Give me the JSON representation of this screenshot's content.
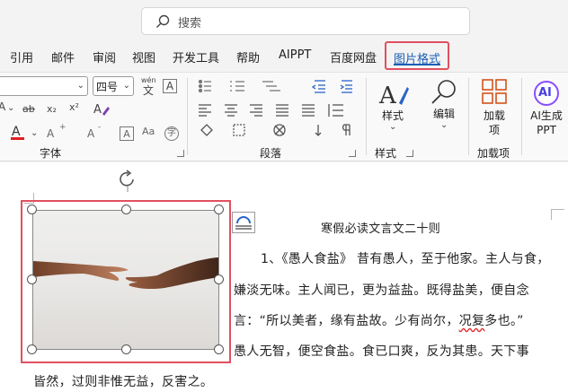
{
  "search": {
    "placeholder": "搜索"
  },
  "tabs": [
    {
      "label": "引用",
      "active": false
    },
    {
      "label": "邮件",
      "active": false
    },
    {
      "label": "审阅",
      "active": false
    },
    {
      "label": "视图",
      "active": false
    },
    {
      "label": "开发工具",
      "active": false
    },
    {
      "label": "帮助",
      "active": false
    },
    {
      "label": "AIPPT",
      "active": false
    },
    {
      "label": "百度网盘",
      "active": false
    },
    {
      "label": "图片格式",
      "active": true
    }
  ],
  "ribbon": {
    "font_size_value": "四号",
    "wen_label": "wén",
    "wen_char": "文",
    "char_a": "A",
    "font_group_label": "字体",
    "para_group_label": "段落",
    "styles_button_label": "样式",
    "styles_group_label": "样式",
    "edit_button_label": "编辑",
    "addin_button_label": "加载项",
    "addin_group_label": "加载项",
    "ai_badge_text": "AI",
    "ai_button_label": "AI生成PPT",
    "strike_label": "ab",
    "sub_label": "x₂",
    "sup_label": "x²",
    "font_color_a": "A",
    "highlight_color": "#f4e94a",
    "font_color": "#e02020",
    "font_color_bar": "#e02020"
  },
  "document": {
    "title": "寒假必读文言文二十则",
    "lines": [
      "1、《愚人食盐》 昔有愚人，至于他家。主人与食，",
      "嫌淡无味。主人闻已，更为益盐。既得盐美，便自念",
      "言：“所以美者，缘有盐故。少有尚尔，",
      "况复",
      "多也。”",
      "愚人无智，便空食盐。食已口爽，反为其患。天下事",
      "皆然，过则非惟无益，反害之。"
    ]
  },
  "colors": {
    "accent": "#1a5fb4",
    "selection": "#e05060",
    "ai_gradient_from": "#3a7bff",
    "ai_gradient_to": "#b03cff"
  }
}
